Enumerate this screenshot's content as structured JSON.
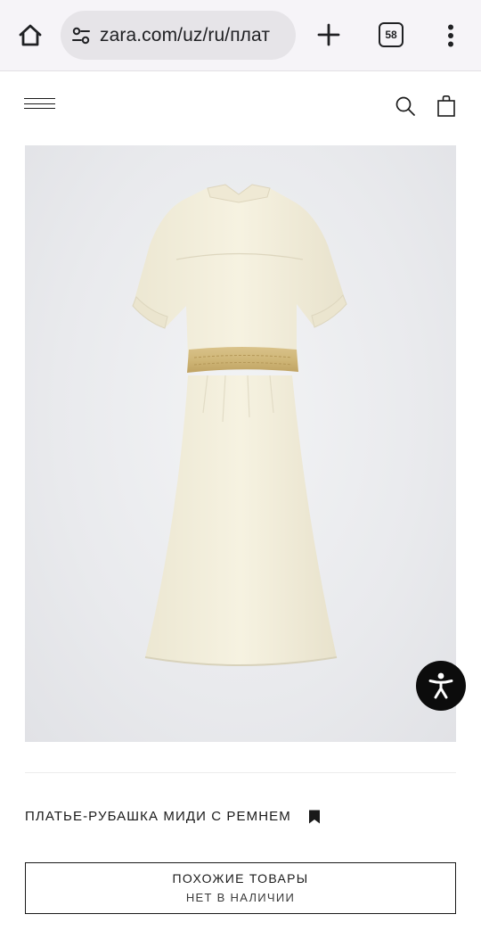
{
  "browser": {
    "url": "zara.com/uz/ru/плат",
    "tab_count": "58",
    "icons": {
      "home": "home-icon",
      "site_info": "tune-icon",
      "new_tab": "plus-icon",
      "tabs": "tab-switcher-icon",
      "menu": "more-vert-icon"
    }
  },
  "header": {
    "icons": [
      "menu-icon",
      "search-icon",
      "shopping-bag-icon"
    ]
  },
  "product": {
    "title": "ПЛАТЬЕ-РУБАШКА МИДИ С РЕМНЕМ",
    "image_icon": "dress-image",
    "bookmark_icon": "bookmark-icon"
  },
  "accessibility": {
    "icon": "accessibility-icon",
    "color": "#0c0c0c"
  },
  "similar": {
    "label": "ПОХОЖИЕ ТОВАРЫ",
    "status": "НЕТ В НАЛИЧИИ"
  }
}
